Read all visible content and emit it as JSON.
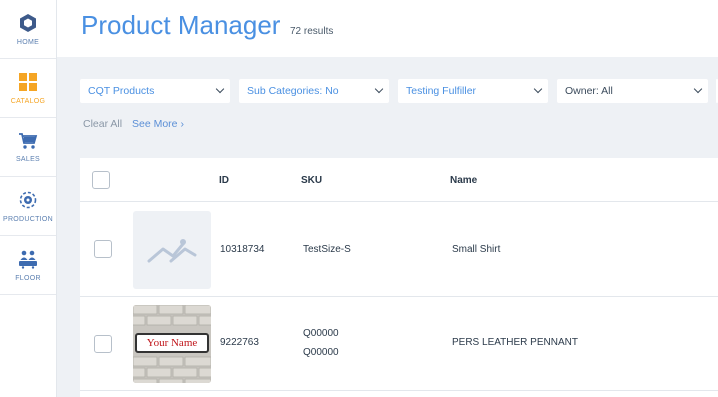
{
  "sidebar": {
    "items": [
      {
        "label": "HOME",
        "icon": "hexagon-icon",
        "active": false
      },
      {
        "label": "CATALOG",
        "icon": "grid-icon",
        "active": true
      },
      {
        "label": "SALES",
        "icon": "cart-icon",
        "active": false
      },
      {
        "label": "PRODUCTION",
        "icon": "gear-icon",
        "active": false
      },
      {
        "label": "FLOOR",
        "icon": "workers-icon",
        "active": false
      }
    ]
  },
  "header": {
    "title": "Product Manager",
    "results": "72 results"
  },
  "filters": [
    {
      "label": "CQT Products"
    },
    {
      "label": "Sub Categories: No"
    },
    {
      "label": "Testing Fulfiller"
    },
    {
      "label": "Owner: All"
    }
  ],
  "filter_actions": {
    "clear_all": "Clear All",
    "see_more": "See More ›"
  },
  "table": {
    "columns": [
      "ID",
      "SKU",
      "Name"
    ],
    "rows": [
      {
        "id": "10318734",
        "sku": [
          "TestSize-S"
        ],
        "name": "Small Shirt",
        "thumb": "placeholder"
      },
      {
        "id": "9222763",
        "sku": [
          "Q00000",
          "Q00000"
        ],
        "name": "PERS LEATHER PENNANT",
        "thumb": "brick",
        "thumb_text": "Your Name"
      }
    ]
  },
  "colors": {
    "accent": "#4a90e2",
    "active_nav": "#f5a524",
    "background": "#eef1f5"
  }
}
